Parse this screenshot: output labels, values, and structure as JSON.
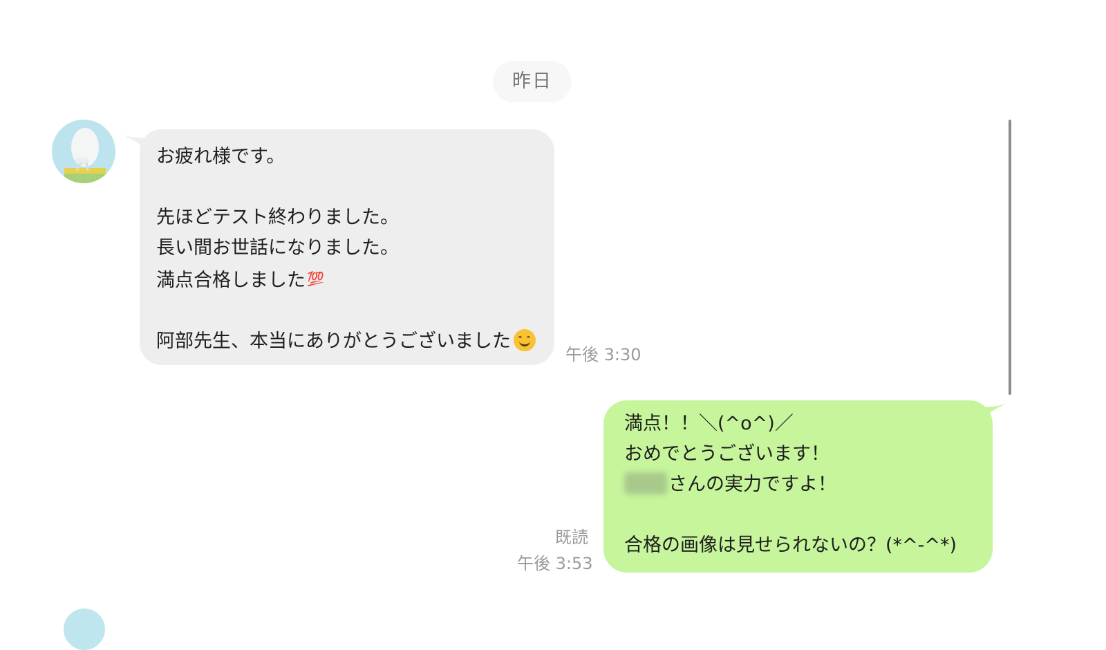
{
  "date_separator": "昨日",
  "incoming": {
    "text_main": "お疲れ様です。\n\n先ほどテスト終わりました。\n長い間お世話になりました。\n満点合格しました",
    "emoji_100": "💯",
    "text_end": "\n\n阿部先生、本当にありがとうございました",
    "emoji_smile": "smiling-face-icon",
    "time": "午後 3:30"
  },
  "outgoing": {
    "line1": "満点！！＼(^o^)／",
    "line2": "おめでとうございます！",
    "line3_suffix": "さんの実力ですよ！",
    "line4": "合格の画像は見せられないの？(*^-^*)",
    "read_receipt": "既読",
    "time": "午後 3:53"
  },
  "colors": {
    "incoming_bubble": "#eeeeee",
    "outgoing_bubble": "#c6f59c",
    "timestamp": "#9a9a9a"
  }
}
